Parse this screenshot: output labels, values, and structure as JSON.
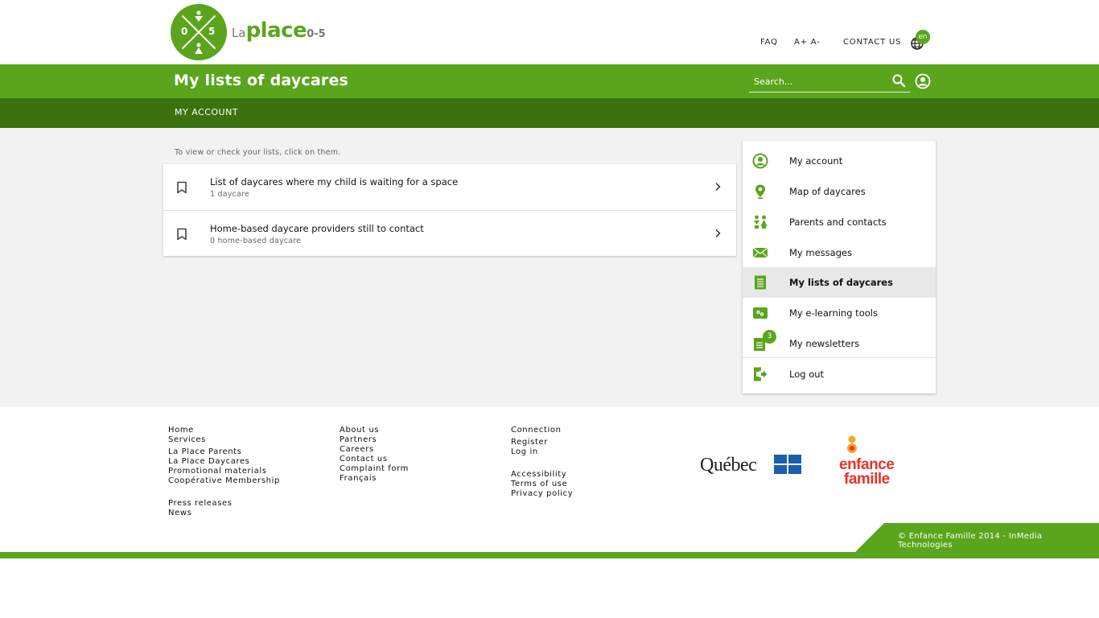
{
  "brand": {
    "logo_la": "La",
    "logo_place": "place",
    "logo_age": "0-5",
    "logo_digit_left": "0",
    "logo_digit_right": "5",
    "accent_color": "#5aa51c",
    "dark_accent_color": "#3a7210"
  },
  "toplinks": {
    "faq": "FAQ",
    "font_size": "A+ A-",
    "contact": "CONTACT US",
    "lang_badge": "en",
    "lang_icon": "globe-icon"
  },
  "header": {
    "title": "My lists of daycares",
    "search_placeholder": "Search...",
    "search_icon": "search-icon",
    "user_icon": "user-circle-icon"
  },
  "subnav": {
    "my_account": "MY ACCOUNT"
  },
  "main": {
    "hint": "To view or check your lists, click on them.",
    "lists": [
      {
        "title": "List of daycares where my child is waiting for a space",
        "subtitle": "1 daycare"
      },
      {
        "title": "Home-based daycare providers still to contact",
        "subtitle": "0 home-based daycare"
      }
    ]
  },
  "sidemenu": {
    "items": [
      {
        "label": "My account",
        "icon": "user-circle-icon"
      },
      {
        "label": "Map of daycares",
        "icon": "map-pin-icon"
      },
      {
        "label": "Parents and contacts",
        "icon": "people-icon"
      },
      {
        "label": "My messages",
        "icon": "envelope-icon"
      },
      {
        "label": "My lists of daycares",
        "icon": "list-icon",
        "active": true
      },
      {
        "label": "My e-learning tools",
        "icon": "e-learning-icon"
      },
      {
        "label": "My newsletters",
        "icon": "newsletter-icon",
        "badge": "3"
      },
      {
        "label": "Log out",
        "icon": "logout-icon"
      }
    ]
  },
  "footer": {
    "col1": [
      "Home",
      "Services",
      "La Place Parents",
      "La Place Daycares",
      "Promotional materials",
      "Coopérative Membership",
      "Press releases",
      "News"
    ],
    "col2": [
      "About us",
      "Partners",
      "Careers",
      "Contact us",
      "Complaint form",
      "Français"
    ],
    "col3": [
      "Connection",
      "Register",
      "Log in",
      "Accessibility",
      "Terms of use",
      "Privacy policy"
    ],
    "quebec_logo": "Québec",
    "ef_logo_line1": "enfance",
    "ef_logo_line2": "famille",
    "copyright": "© Enfance Famille 2014 - InMedia Technologies"
  }
}
